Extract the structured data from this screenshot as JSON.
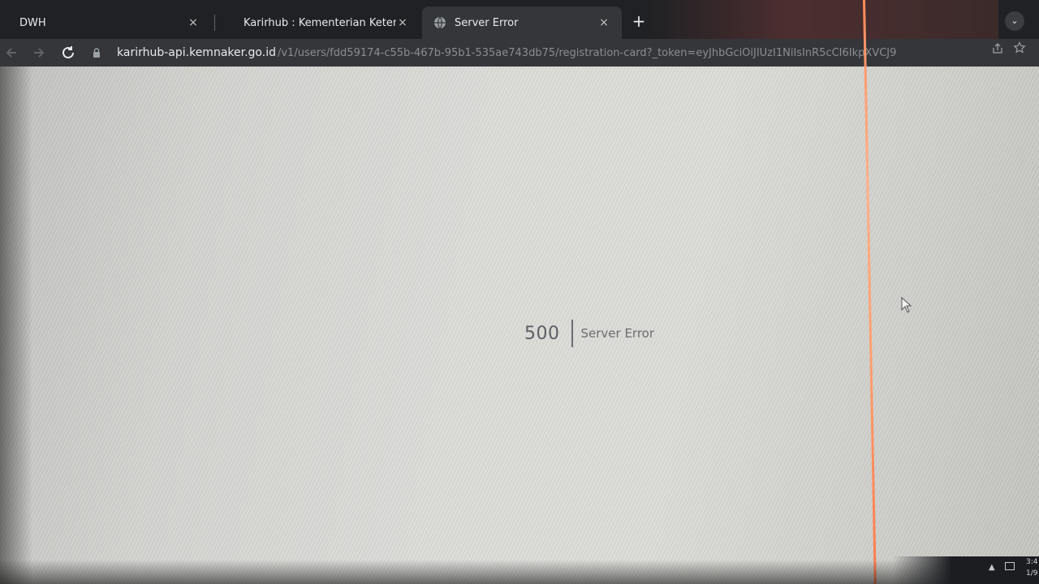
{
  "browser": {
    "tabs": [
      {
        "label": "DWH",
        "active": false,
        "close": "×"
      },
      {
        "label": "Karirhub : Kementerian Ketenag",
        "active": false,
        "close": "×"
      },
      {
        "label": "Server Error",
        "active": true,
        "close": "×",
        "icon": "globe-icon"
      }
    ],
    "new_tab": "+",
    "tab_dropdown": "⌄",
    "address": {
      "host": "karirhub-api.kemnaker.go.id",
      "path": "/v1/users/fdd59174-c55b-467b-95b1-535ae743db75/registration-card?_token=eyJhbGciOiJIUzI1NiIsInR5cCI6IkpXVCJ9",
      "icon": "lock-icon"
    }
  },
  "page": {
    "error_code": "500",
    "error_message": "Server Error"
  },
  "taskbar": {
    "time": "3:4",
    "date": "1/9"
  },
  "colors": {
    "tab_strip": "#202124",
    "toolbar": "#35363a",
    "page_background": "#dcdcd9",
    "error_text": "#5c5f63",
    "scan_line": "#ff8a5a"
  }
}
